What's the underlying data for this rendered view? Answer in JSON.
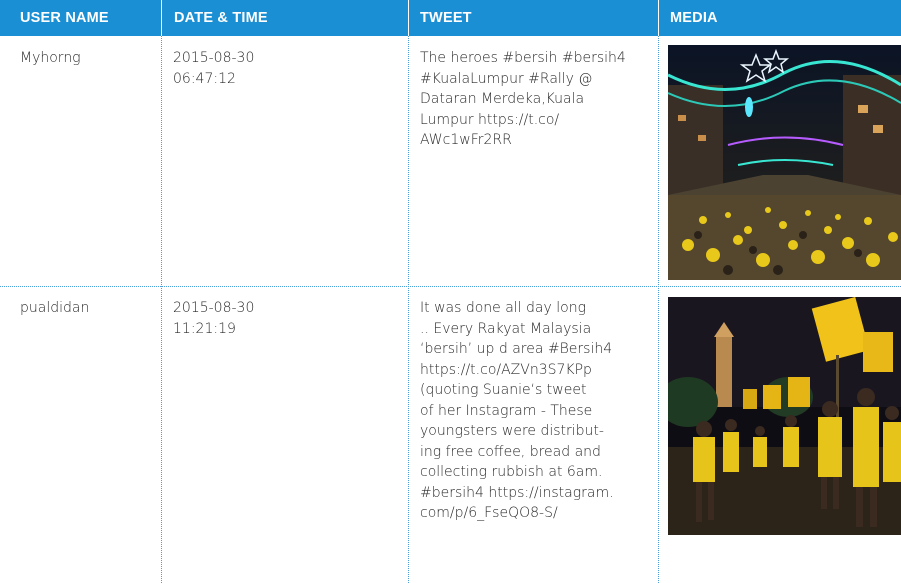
{
  "columns": {
    "user": "USER NAME",
    "datetime": "DATE & TIME",
    "tweet": "TWEET",
    "media": "MEDIA"
  },
  "colors": {
    "header_bg": "#1b8fd4",
    "grid": "#4a9fd8",
    "text": "#2b2b2b"
  },
  "rows": [
    {
      "user": "Myhorng",
      "date": "2015-08-30",
      "time": "06:47:12",
      "tweet": "The heroes #bersih #bersih4\n#KualaLumpur #Rally @\nDataran Merdeka,Kuala\nLumpur https://t.co/\nAWc1wFr2RR",
      "media_icon": "rally-street-night-photo"
    },
    {
      "user": "pualdidan",
      "date": "2015-08-30",
      "time": "11:21:19",
      "tweet": "It was done all day long\n.. Every Rakyat Malaysia\n‘bersih’ up d area #Bersih4\nhttps://t.co/AZVn3S7KPp\n(quoting Suanie‘s tweet\nof her Instagram - These\nyoungsters were distribut-\ning free coffee, bread and\ncollecting rubbish at 6am.\n#bersih4 https://instagram.\ncom/p/6_FseQO8-S/",
      "media_icon": "protesters-placards-night-photo"
    }
  ]
}
